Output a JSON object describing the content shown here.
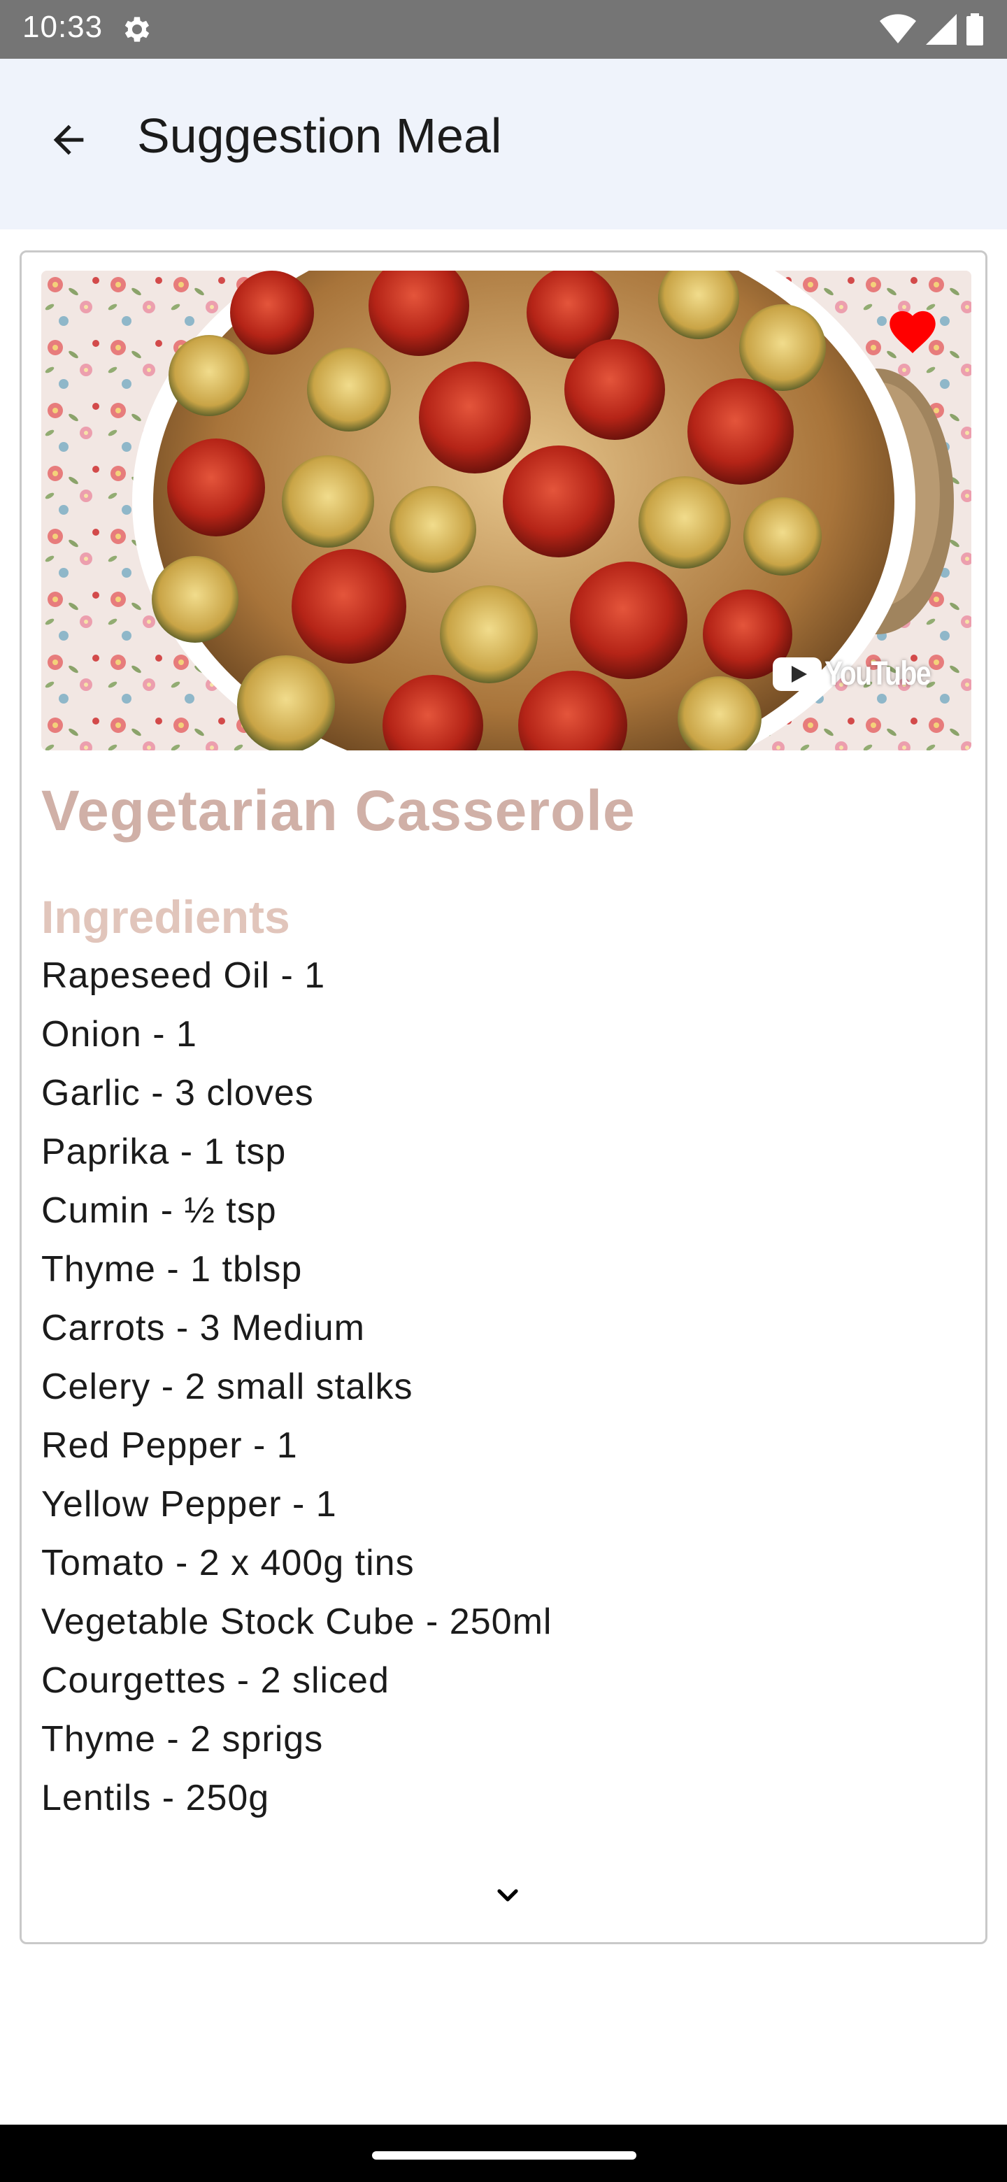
{
  "status_bar": {
    "time": "10:33",
    "icons": [
      "gear-icon",
      "wifi-icon",
      "signal-icon",
      "battery-icon"
    ]
  },
  "app_bar": {
    "title": "Suggestion Meal",
    "back_icon": "arrow-back-icon"
  },
  "meal": {
    "name": "Vegetarian Casserole",
    "favorite_icon": "heart-icon",
    "favorite_color": "#ff0000",
    "video_badge": "YouTube",
    "ingredients_heading": "Ingredients",
    "ingredients": [
      "Rapeseed Oil - 1",
      "Onion - 1",
      "Garlic - 3 cloves",
      "Paprika - 1 tsp",
      "Cumin - ½ tsp",
      "Thyme - 1 tblsp",
      "Carrots - 3 Medium",
      "Celery - 2 small stalks",
      "Red Pepper - 1",
      "Yellow Pepper - 1",
      "Tomato - 2 x 400g tins",
      "Vegetable Stock Cube - 250ml",
      "Courgettes - 2 sliced",
      "Thyme - 2 sprigs",
      "Lentils - 250g"
    ],
    "expand_icon": "chevron-down-icon"
  },
  "colors": {
    "meal_name": "#d0b0a7",
    "ingredients_heading": "#e1c5bb",
    "app_bar_bg": "#eff3fb",
    "status_bar_bg": "#757575"
  }
}
